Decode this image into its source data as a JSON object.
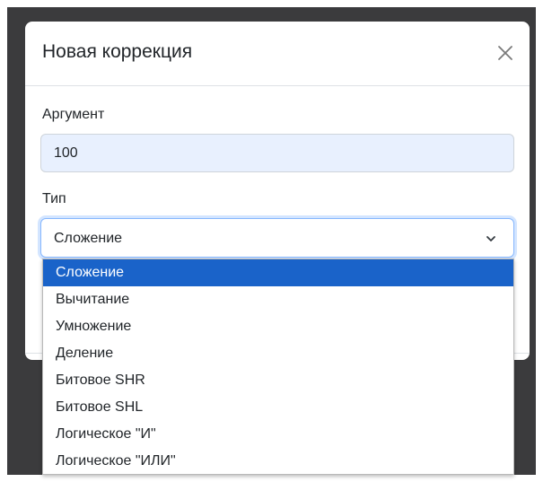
{
  "modal": {
    "title": "Новая коррекция",
    "close_icon": "close-icon"
  },
  "form": {
    "argument": {
      "label": "Аргумент",
      "value": "100"
    },
    "type": {
      "label": "Тип",
      "selected": "Сложение",
      "chevron_icon": "chevron-down-icon",
      "options": [
        "Сложение",
        "Вычитание",
        "Умножение",
        "Деление",
        "Битовое SHR",
        "Битовое SHL",
        "Логическое \"И\"",
        "Логическое \"ИЛИ\""
      ]
    }
  },
  "colors": {
    "backdrop": "#3b3b3d",
    "input_fill": "#e8f0fe",
    "selected_option": "#1a63c9",
    "focus_border": "#86b7fe"
  }
}
